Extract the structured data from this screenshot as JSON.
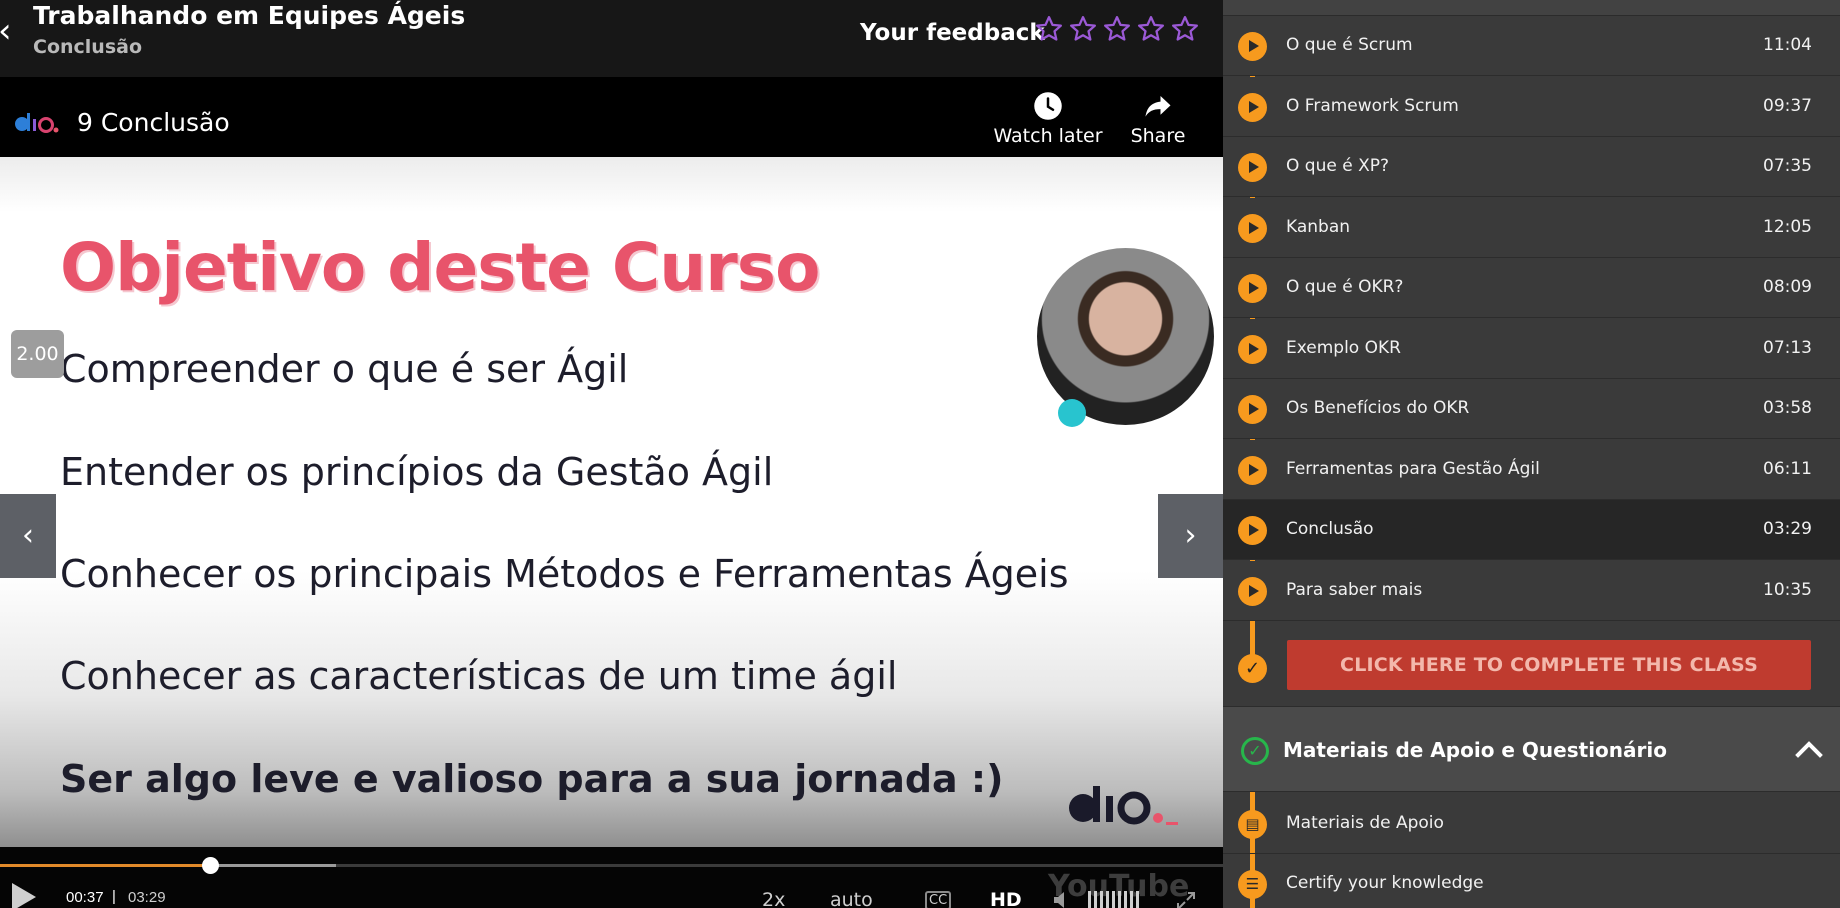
{
  "header": {
    "course_title": "Trabalhando em Equipes Ágeis",
    "lesson_subtitle": "Conclusão",
    "feedback_label": "Your feedback",
    "rating": {
      "filled": 0,
      "max": 5
    },
    "star_color": "#9b59d6"
  },
  "player": {
    "video_title": "9 Conclusão",
    "watch_later_label": "Watch later",
    "share_label": "Share",
    "speed_badge": "2.00",
    "slide": {
      "heading": "Objetivo deste Curso",
      "lines": [
        "Compreender o que é ser Ágil",
        "Entender os princípios da Gestão Ágil",
        "Conhecer os principais Métodos e Ferramentas Ágeis",
        "Conhecer as características de um time ágil",
        "Ser algo leve e valioso para a sua jornada :)"
      ]
    },
    "controls": {
      "current_time": "00:37",
      "separator": "|",
      "total_time": "03:29",
      "played_fraction": 0.172,
      "buffered_fraction": 0.275,
      "speed": "2x",
      "quality_mode": "auto",
      "cc": "CC",
      "hd": "HD",
      "watermark": "YouTube"
    },
    "accent_color": "#e28a2a"
  },
  "sidebar": {
    "lessons": [
      {
        "title": "O que é Scrum",
        "duration": "11:04"
      },
      {
        "title": "O Framework Scrum",
        "duration": "09:37"
      },
      {
        "title": "O que é XP?",
        "duration": "07:35"
      },
      {
        "title": "Kanban",
        "duration": "12:05"
      },
      {
        "title": "O que é OKR?",
        "duration": "08:09"
      },
      {
        "title": "Exemplo OKR",
        "duration": "07:13"
      },
      {
        "title": "Os Benefícios do OKR",
        "duration": "03:58"
      },
      {
        "title": "Ferramentas para Gestão Ágil",
        "duration": "06:11"
      },
      {
        "title": "Conclusão",
        "duration": "03:29",
        "active": true
      },
      {
        "title": "Para saber mais",
        "duration": "10:35"
      }
    ],
    "complete_button": "CLICK HERE TO COMPLETE THIS CLASS",
    "section_title": "Materiais de Apoio e Questionário",
    "materials": [
      {
        "title": "Materiais de Apoio",
        "icon": "document-icon"
      },
      {
        "title": "Certify your knowledge",
        "icon": "list-icon"
      }
    ],
    "timeline_color": "#f79a1e",
    "complete_color": "#bf3b2f"
  }
}
